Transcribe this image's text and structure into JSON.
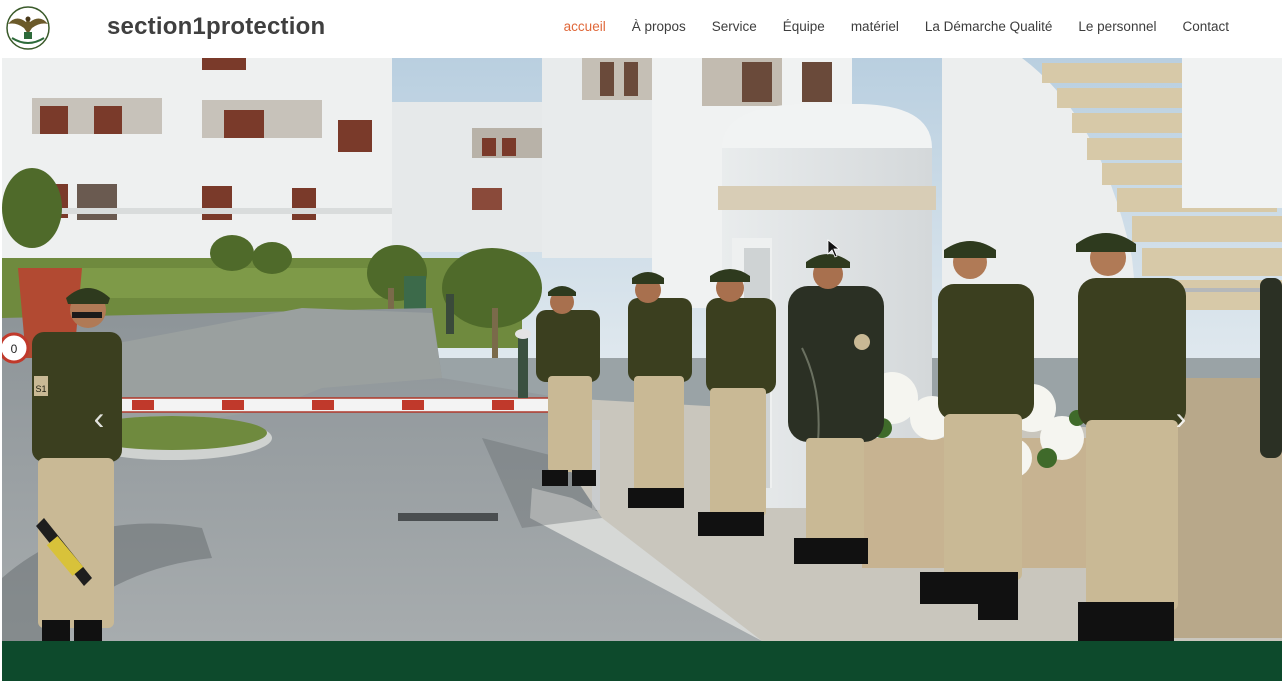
{
  "header": {
    "brand": "section1protection",
    "logo_icon": "eagle-emblem-icon"
  },
  "nav": {
    "items": [
      {
        "label": "accueil",
        "active": true
      },
      {
        "label": "À propos",
        "active": false
      },
      {
        "label": "Service",
        "active": false
      },
      {
        "label": "Équipe",
        "active": false
      },
      {
        "label": "matériel",
        "active": false
      },
      {
        "label": "La Démarche Qualité",
        "active": false
      },
      {
        "label": "Le personnel",
        "active": false
      },
      {
        "label": "Contact",
        "active": false
      }
    ]
  },
  "hero": {
    "prev_icon": "chevron-left-icon",
    "next_icon": "chevron-right-icon",
    "prev_glyph": "‹",
    "next_glyph": "›",
    "sign_text": "0",
    "badge_text": "S1"
  },
  "colors": {
    "accent": "#e0683a",
    "brand_text": "#3f3f3f",
    "footer": "#0d4a2c",
    "uniform": "#3b3f1f",
    "trousers": "#c9b995"
  }
}
